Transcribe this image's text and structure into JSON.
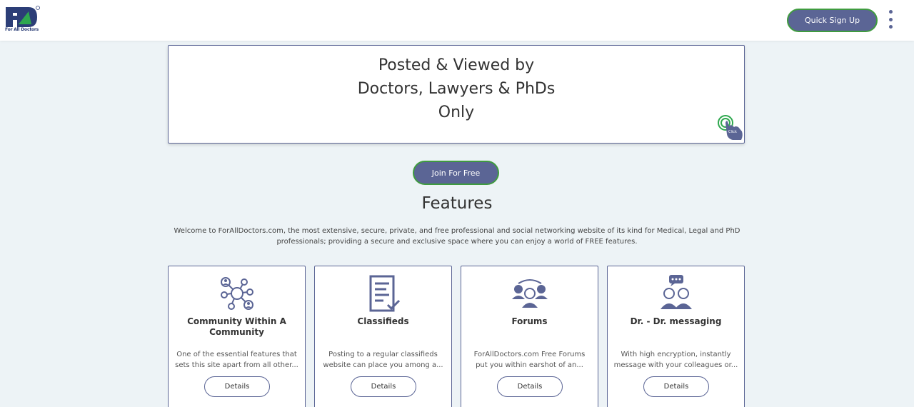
{
  "header": {
    "logo_text": "For All Doctors",
    "signup_label": "Quick Sign Up",
    "menu_icon": "more-vertical-icon"
  },
  "banner": {
    "line1": "Posted & Viewed by",
    "line2": "Doctors, Lawyers & PhDs",
    "line3": "Only",
    "click_label": "Click"
  },
  "join_label": "Join For Free",
  "features": {
    "title": "Features",
    "description": "Welcome to ForAllDoctors.com, the most extensive, secure, private, and free professional and social networking website of its kind for Medical, Legal and PhD professionals; providing a secure and exclusive space where you can enjoy a world of FREE features.",
    "cards": [
      {
        "title": "Community Within A Community",
        "desc": "One of the essential features that sets this site apart from all other...",
        "button": "Details",
        "icon": "community-network-icon"
      },
      {
        "title": "Classifieds",
        "desc": "Posting to a regular classifieds website can place you among a...",
        "button": "Details",
        "icon": "document-check-icon"
      },
      {
        "title": "Forums",
        "desc": "ForAllDoctors.com Free Forums put you within earshot of an...",
        "button": "Details",
        "icon": "forum-group-icon"
      },
      {
        "title": "Dr. - Dr. messaging",
        "desc": "With high encryption, instantly message with your colleagues or...",
        "button": "Details",
        "icon": "doctor-messaging-icon"
      }
    ]
  },
  "colors": {
    "accent": "#5b6595",
    "button_border": "#3f9b3f",
    "background": "#edf3f6",
    "logo_green": "#2fa84f"
  }
}
